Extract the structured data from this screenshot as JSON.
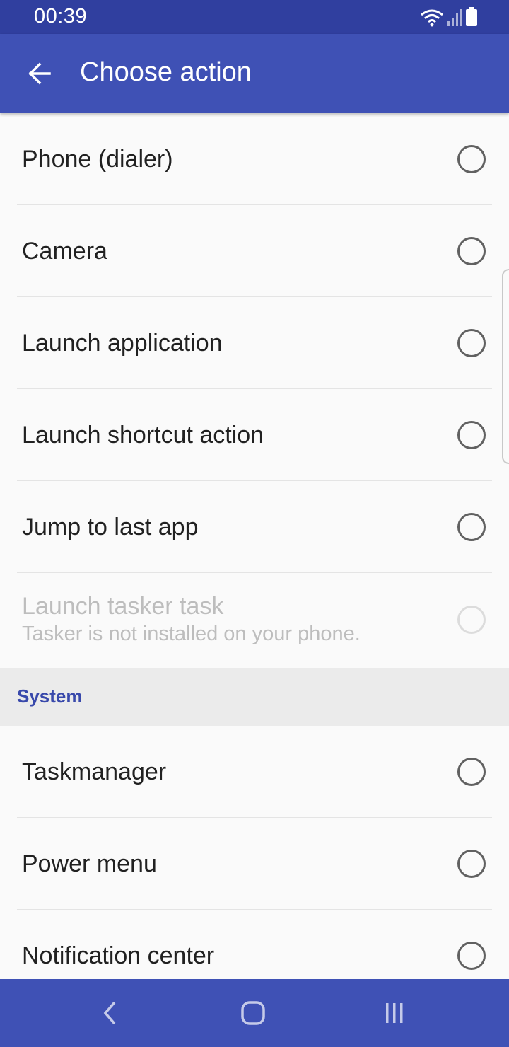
{
  "status_bar": {
    "time": "00:39",
    "icons": [
      "wifi-icon",
      "signal-icon",
      "battery-icon"
    ]
  },
  "app_bar": {
    "title": "Choose action",
    "back_icon": "arrow-left-icon"
  },
  "items_top": [
    {
      "label": "Phone (dialer)",
      "selected": false
    },
    {
      "label": "Camera",
      "selected": false
    },
    {
      "label": "Launch application",
      "selected": false
    },
    {
      "label": "Launch shortcut action",
      "selected": false
    },
    {
      "label": "Jump to last app",
      "selected": false
    }
  ],
  "disabled_item": {
    "label": "Launch tasker task",
    "subtitle": "Tasker is not installed on your phone."
  },
  "section": {
    "label": "System"
  },
  "items_system": [
    {
      "label": "Taskmanager",
      "selected": false
    },
    {
      "label": "Power menu",
      "selected": false
    },
    {
      "label": "Notification center",
      "selected": false
    }
  ],
  "nav_bar": {
    "icons": [
      "back-icon",
      "home-icon",
      "recents-icon"
    ]
  },
  "colors": {
    "primary": "#3f51b5",
    "primary_dark": "#303f9f",
    "section_text": "#3949ab"
  }
}
